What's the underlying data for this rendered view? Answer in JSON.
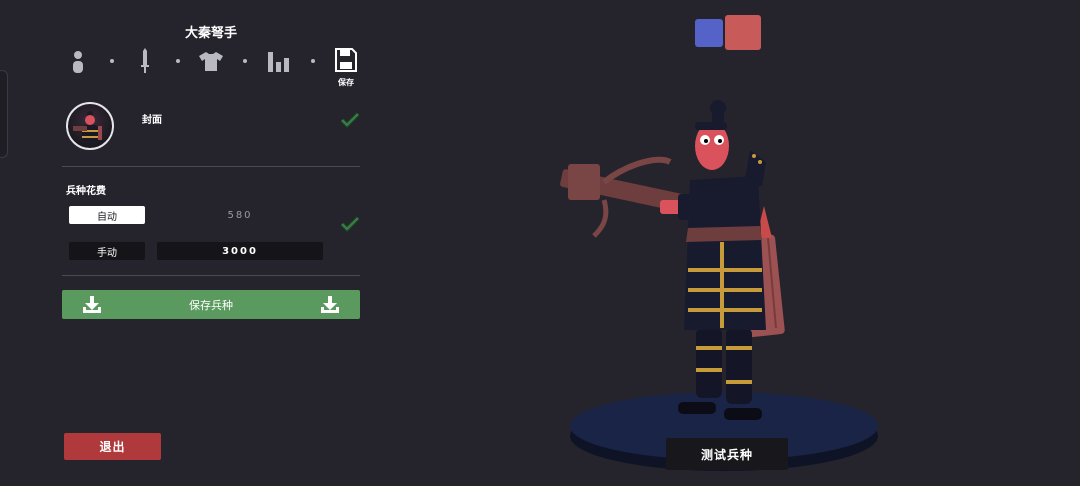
{
  "editor": {
    "unit_name": "大秦弩手",
    "tabs": [
      {
        "id": "body",
        "icon": "person-icon"
      },
      {
        "id": "weapon",
        "icon": "sword-icon"
      },
      {
        "id": "clothing",
        "icon": "shirt-icon"
      },
      {
        "id": "stats",
        "icon": "bar-chart-icon"
      },
      {
        "id": "save",
        "icon": "floppy-disk-icon",
        "label": "保存"
      }
    ],
    "cover": {
      "label": "封面",
      "checked": true
    },
    "cost": {
      "title": "兵种花费",
      "auto_label": "自动",
      "auto_value": "580",
      "manual_label": "手动",
      "manual_value": "3000",
      "selected": "auto",
      "checked": true
    },
    "save_unit_label": "保存兵种",
    "exit_label": "退出"
  },
  "teams": [
    {
      "name": "blue",
      "color": "#5563c8",
      "selected": false
    },
    {
      "name": "red",
      "color": "#c85a5a",
      "selected": true
    }
  ],
  "preview": {
    "test_label": "测试兵种"
  },
  "colors": {
    "background": "#25242c",
    "save_green": "#5a9a5e",
    "exit_red": "#b0393b",
    "check_green": "#2f6b3a"
  }
}
